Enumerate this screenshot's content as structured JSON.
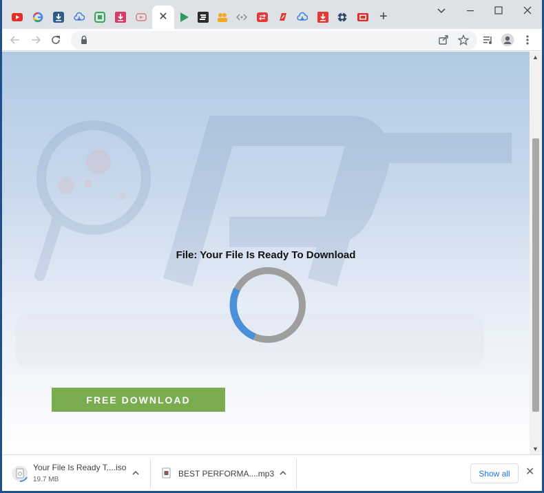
{
  "browser": {
    "tabs": [
      {
        "icon": "youtube-icon",
        "color": "#e52d27"
      },
      {
        "icon": "google-icon",
        "color": "#4285f4"
      },
      {
        "icon": "download-icon",
        "color": "#2e5d87"
      },
      {
        "icon": "cloud-download-icon",
        "color": "#3b7dd8"
      },
      {
        "icon": "green-box-icon",
        "color": "#34a853"
      },
      {
        "icon": "pink-download-icon",
        "color": "#d93a6a"
      },
      {
        "icon": "video-play-icon",
        "color": "#e0787c"
      },
      {
        "icon": "close-icon",
        "active": true
      },
      {
        "icon": "green-play-icon",
        "color": "#2d9b5b"
      },
      {
        "icon": "dark-logo-icon",
        "color": "#2c2c2c"
      },
      {
        "icon": "orange-people-icon",
        "color": "#f5a623"
      },
      {
        "icon": "code-brackets-icon",
        "color": "#888888"
      },
      {
        "icon": "red-arrows-icon",
        "color": "#e53935"
      },
      {
        "icon": "red-leaf-icon",
        "color": "#e53935"
      },
      {
        "icon": "cloud-download-icon",
        "color": "#3b7dd8"
      },
      {
        "icon": "red-download-icon",
        "color": "#e53935"
      },
      {
        "icon": "gear-icon",
        "color": "#2c4a6e"
      },
      {
        "icon": "youtube-icon",
        "color": "#e52d27"
      }
    ],
    "new_tab_icon": "plus-icon",
    "controls": [
      "chevron-down-icon",
      "minimize-icon",
      "maximize-icon",
      "close-icon"
    ]
  },
  "toolbar": {
    "url": "",
    "icons": [
      "back-icon",
      "forward-icon",
      "reload-icon",
      "lock-icon",
      "share-icon",
      "star-icon",
      "media-control-icon",
      "profile-icon",
      "menu-icon"
    ]
  },
  "page": {
    "title": "File: Your File Is Ready To Download",
    "button_label": "FREE DOWNLOAD",
    "spinner_colors": {
      "track": "#9e9e9e",
      "progress": "#4a90d9"
    },
    "accent": "#7aad4f"
  },
  "downloads": {
    "items": [
      {
        "name": "Your File Is Ready T....iso",
        "size": "19.7 MB",
        "icon": "file-icon"
      },
      {
        "name": "BEST PERFORMA....mp3",
        "size": "",
        "icon": "audio-file-icon"
      }
    ],
    "show_all": "Show all"
  }
}
